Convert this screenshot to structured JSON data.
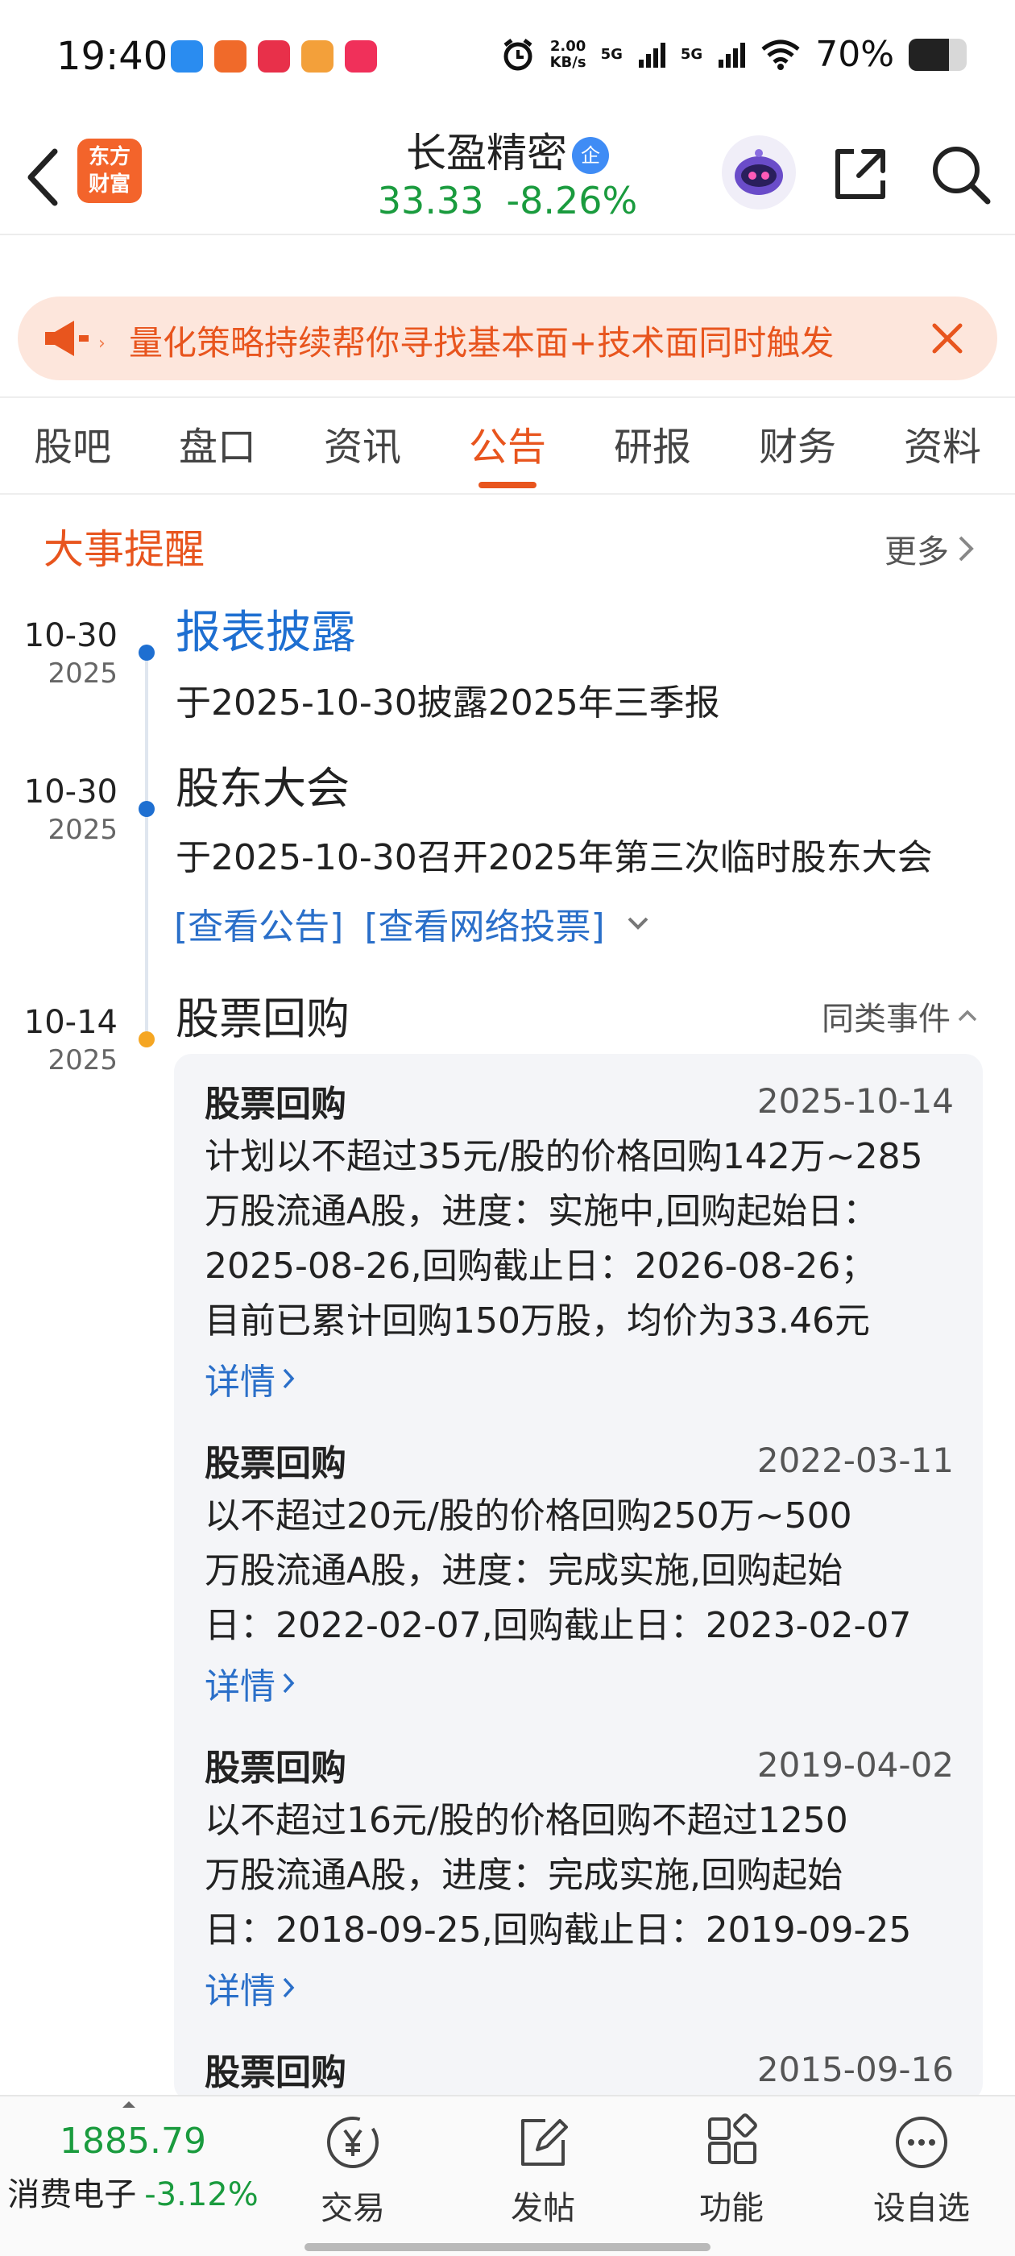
{
  "status_bar": {
    "time": "19:40",
    "speed_value": "2.00",
    "speed_unit": "KB/s",
    "net1": "5G",
    "net2": "5G",
    "battery_text": "70%",
    "battery_level": 0.7
  },
  "header": {
    "logo_line1": "东方",
    "logo_line2": "财富",
    "stock_name": "长盈精密",
    "badge": "企",
    "price": "33.33",
    "change": "-8.26%"
  },
  "banner": {
    "text": "量化策略持续帮你寻找基本面+技术面同时触发"
  },
  "tabs": [
    {
      "label": "股吧"
    },
    {
      "label": "盘口"
    },
    {
      "label": "资讯"
    },
    {
      "label": "公告",
      "active": true
    },
    {
      "label": "研报"
    },
    {
      "label": "财务"
    },
    {
      "label": "资料"
    }
  ],
  "section": {
    "title": "大事提醒",
    "more": "更多"
  },
  "events": [
    {
      "md": "10-30",
      "year": "2025",
      "title": "报表披露",
      "desc": "于2025-10-30披露2025年三季报"
    },
    {
      "md": "10-30",
      "year": "2025",
      "title": "股东大会",
      "desc": "于2025-10-30召开2025年第三次临时股东大会",
      "link1": "[查看公告]",
      "link2": "[查看网络投票]"
    },
    {
      "md": "10-14",
      "year": "2025",
      "title": "股票回购",
      "similar": "同类事件"
    }
  ],
  "buyback_cards": [
    {
      "title": "股票回购",
      "date": "2025-10-14",
      "lines": [
        "计划以不超过35元/股的价格回购142万~285",
        "万股流通A股，进度：实施中,回购起始日：",
        "2025-08-26,回购截止日：2026-08-26；",
        "目前已累计回购150万股，均价为33.46元"
      ],
      "link": "详情"
    },
    {
      "title": "股票回购",
      "date": "2022-03-11",
      "lines": [
        "以不超过20元/股的价格回购250万~500",
        "万股流通A股，进度：完成实施,回购起始",
        "日：2022-02-07,回购截止日：2023-02-07"
      ],
      "link": "详情"
    },
    {
      "title": "股票回购",
      "date": "2019-04-02",
      "lines": [
        "以不超过16元/股的价格回购不超过1250",
        "万股流通A股，进度：完成实施,回购起始",
        "日：2018-09-25,回购截止日：2019-09-25"
      ],
      "link": "详情"
    },
    {
      "title": "股票回购",
      "date": "2015-09-16"
    }
  ],
  "bottom_nav": {
    "index_value": "1885.79",
    "index_name": "消费电子",
    "index_change": "-3.12%",
    "items": [
      {
        "label": "交易",
        "icon": "yuan-icon"
      },
      {
        "label": "发帖",
        "icon": "edit-icon"
      },
      {
        "label": "功能",
        "icon": "grid-icon"
      },
      {
        "label": "设自选",
        "icon": "more-icon"
      }
    ]
  },
  "colors": {
    "accent": "#e8551e",
    "down_green": "#1a9b3e",
    "link_blue": "#2a6fc9",
    "timeline_blue": "#1e6fd1",
    "timeline_orange": "#f5a623"
  }
}
